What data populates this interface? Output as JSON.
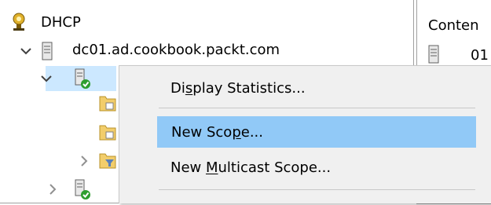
{
  "tree": {
    "root": {
      "label": "DHCP",
      "icon": "dhcp-root-icon"
    },
    "server": {
      "label": "dc01.ad.cookbook.packt.com",
      "icon": "server-icon"
    },
    "ipv4_node": {
      "icon": "server-ok-icon",
      "expanded": true
    },
    "child_items": [
      {
        "icon": "folder-icon"
      },
      {
        "icon": "folder-icon"
      },
      {
        "icon": "filter-folder-icon"
      }
    ],
    "ipv6_node": {
      "icon": "server-ok-icon"
    }
  },
  "content_pane": {
    "header": "Conten",
    "row_text": "01"
  },
  "context_menu": {
    "items": [
      {
        "pre": "Di",
        "accel": "s",
        "post": "play Statistics...",
        "highlighted": false
      },
      {
        "pre": "New Sco",
        "accel": "p",
        "post": "e...",
        "highlighted": true
      },
      {
        "pre": "New ",
        "accel": "M",
        "post": "ulticast Scope...",
        "highlighted": false
      }
    ]
  },
  "colors": {
    "highlight": "#91c9f7",
    "selection": "#cce8ff",
    "menu_bg": "#f0f0f0"
  }
}
